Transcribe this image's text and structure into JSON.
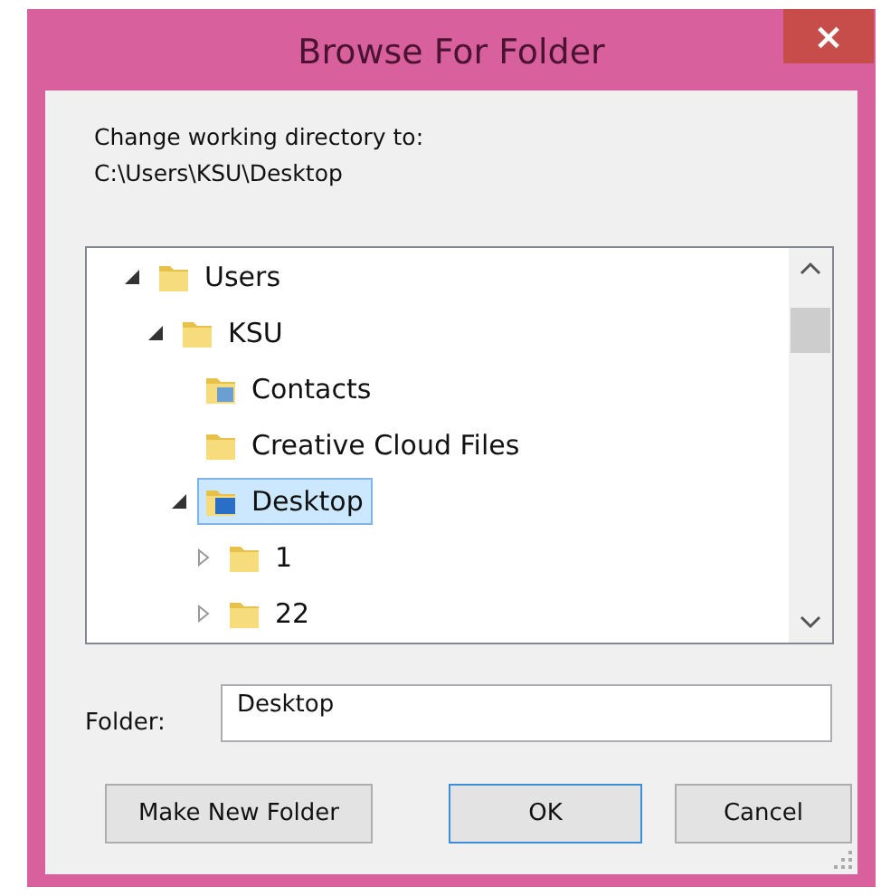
{
  "window": {
    "title": "Browse For Folder",
    "close": "×"
  },
  "description": [
    "Change working directory to:",
    "C:\\Users\\KSU\\Desktop"
  ],
  "tree": [
    {
      "label": "Users",
      "kind": "folder",
      "expandable": true,
      "expanded": true,
      "selected": false,
      "children": [
        {
          "label": "KSU",
          "kind": "folder",
          "expandable": true,
          "expanded": true,
          "selected": false,
          "children": [
            {
              "label": "Contacts",
              "kind": "contacts",
              "expandable": false,
              "selected": false
            },
            {
              "label": "Creative Cloud Files",
              "kind": "folder",
              "expandable": false,
              "selected": false
            },
            {
              "label": "Desktop",
              "kind": "desktop",
              "expandable": true,
              "expanded": true,
              "selected": true,
              "children": [
                {
                  "label": "1",
                  "kind": "folder",
                  "expandable": true,
                  "expanded": false,
                  "selected": false
                },
                {
                  "label": "22",
                  "kind": "folder",
                  "expandable": true,
                  "expanded": false,
                  "selected": false
                }
              ]
            }
          ]
        }
      ]
    }
  ],
  "folder_field": {
    "label": "Folder:",
    "value": "Desktop"
  },
  "buttons": [
    {
      "label": "Make New Folder",
      "default": false
    },
    {
      "label": "OK",
      "default": true
    },
    {
      "label": "Cancel",
      "default": false
    }
  ]
}
